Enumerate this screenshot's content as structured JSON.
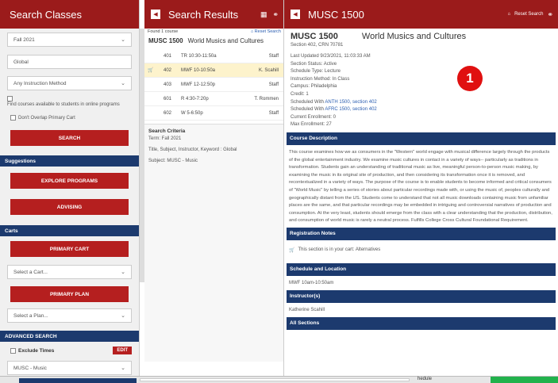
{
  "left": {
    "title": "Search Classes",
    "term": "Fall 2021",
    "campus": "Global",
    "instruction_method": "Any Instruction Method",
    "online_label": "Find courses available to students in online programs",
    "no_overlap_label": "Don't Overlap Primary Cart",
    "search_button": "SEARCH",
    "suggestions_header": "Suggestions",
    "explore_button": "EXPLORE PROGRAMS",
    "advising_button": "ADVISING",
    "carts_header": "Carts",
    "primary_cart_button": "PRIMARY CART",
    "select_cart": "Select a Cart...",
    "primary_plan_button": "PRIMARY PLAN",
    "select_plan": "Select a Plan...",
    "advanced_header": "ADVANCED SEARCH",
    "exclude_times_label": "Exclude Times",
    "edit_button": "EDIT",
    "subject_value": "MUSC - Music"
  },
  "mid": {
    "title": "Search Results",
    "found": "Found 1 course",
    "reset": "Reset Search",
    "course_code": "MUSC 1500",
    "course_name": "World Musics and Cultures",
    "sections": [
      {
        "num": "401",
        "time": "TR 10:30-11:50a",
        "inst": "Staff",
        "cart": false
      },
      {
        "num": "402",
        "time": "MWF 10-10:50a",
        "inst": "K. Scahill",
        "cart": true
      },
      {
        "num": "403",
        "time": "MWF 12-12:50p",
        "inst": "Staff",
        "cart": false
      },
      {
        "num": "601",
        "time": "R 4:30-7:20p",
        "inst": "T. Rommen",
        "cart": false
      },
      {
        "num": "602",
        "time": "W 5-6:50p",
        "inst": "Staff",
        "cart": false
      }
    ],
    "criteria_header": "Search Criteria",
    "criteria_term": "Term: Fall 2021",
    "criteria_keyword": "Title, Subject, Instructor, Keyword : Global",
    "criteria_subject": "Subject: MUSC - Music"
  },
  "right": {
    "title": "MUSC 1500",
    "reset": "Reset Search",
    "course_code": "MUSC 1500",
    "course_name": "World Musics and Cultures",
    "section_line": "Section 402, CRN 70781",
    "details": [
      "Last Updated 9/23/2021, 11:03:33 AM",
      "Section Status: Active",
      "Schedule Type: Lecture",
      "Instruction Method: In Class",
      "Campus: Philadelphia",
      "Credit: 1"
    ],
    "sched_with_1_prefix": "Scheduled With",
    "sched_with_1_link": "ANTH 1500, section 402",
    "sched_with_2_prefix": "Scheduled With",
    "sched_with_2_link": "AFRC 1500, section 402",
    "enrollment": "Current Enrollment: 0",
    "max_enrollment": "Max Enrollment: 27",
    "badge": "1",
    "desc_header": "Course Description",
    "description": "This course examines how we as consumers in the \"Western\" world engage with musical difference largely through the products of the global entertainment industry. We examine music cultures in contact in a variety of ways-- particularly as traditions in transformation. Students gain an understanding of traditional music as live, meaningful person-to-person music making, by examining the music in its original site of production, and then considering its transformation once it is removed, and recontextualized in a variety of ways. The purpose of the course is to enable students to become informed and critical consumers of \"World Music\" by telling a series of stories about particular recordings made with, or using the music of, peoples culturally and geographically distant from the US. Students come to understand that not all music downloads containing music from unfamiliar places are the same, and that particular recordings may be embedded in intriguing and controversial narratives of production and consumption. At the very least, students should emerge from the class with a clear understanding that the production, distribution, and consumption of world music is rarely a neutral process. Fulfills College Cross Cultural Foundational Requirement.",
    "reg_header": "Registration Notes",
    "reg_note": "This section is in your cart: Alternatives",
    "sched_header": "Schedule and Location",
    "sched_value": "MWF 10am-10:50am",
    "instr_header": "Instructor(s)",
    "instr_value": "Katherine Scahill",
    "all_header": "All Sections",
    "bottom_partial": "hedule"
  },
  "colors": {
    "brand_red": "#9b1b1b",
    "button_red": "#b51f1f",
    "navy": "#1c3a6e",
    "link_blue": "#2a5db0",
    "highlight": "#fdf3cc",
    "badge_red": "#e01010"
  }
}
